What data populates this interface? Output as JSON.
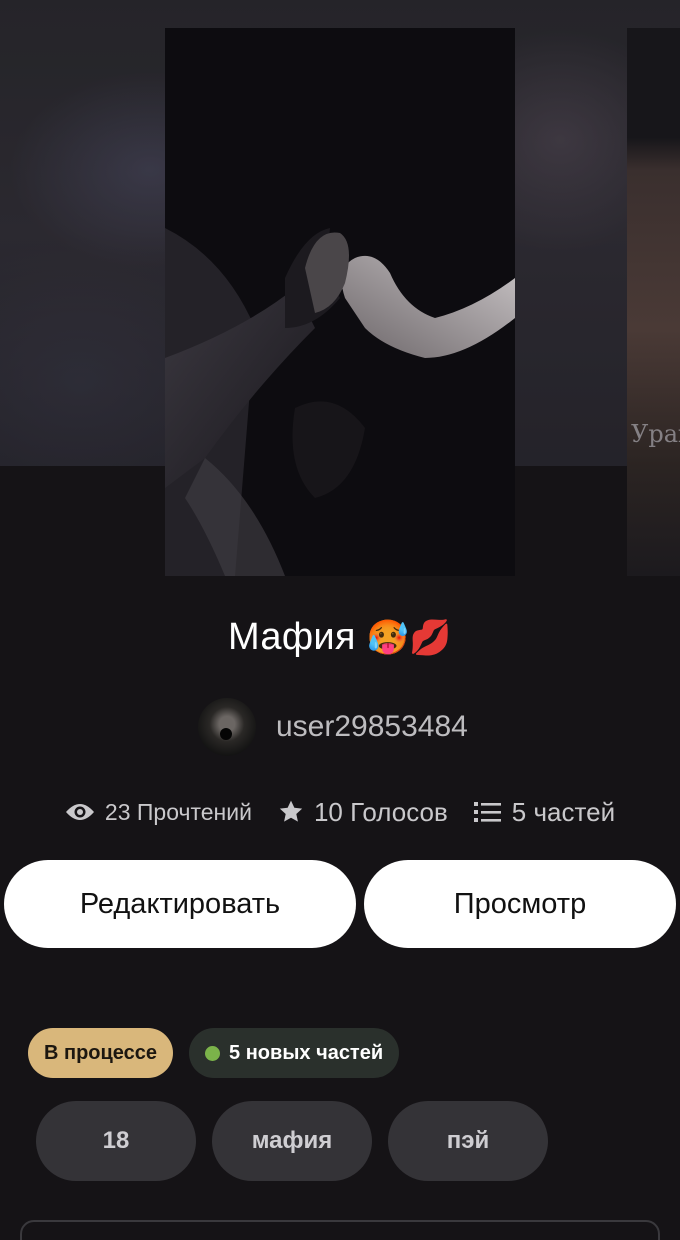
{
  "story": {
    "title": "Мафия",
    "title_emojis": "🥵💋",
    "author": "user29853484"
  },
  "stats": {
    "reads": "23 Прочтений",
    "votes": "10 Голосов",
    "parts": "5 частей"
  },
  "actions": {
    "edit_label": "Редактировать",
    "preview_label": "Просмотр"
  },
  "status": {
    "state_label": "В процессе",
    "new_parts_label": "5 новых частей"
  },
  "tags": [
    "18",
    "мафия",
    "пэй"
  ],
  "next_cover": {
    "visible_text": "Ураг"
  },
  "colors": {
    "background": "#151316",
    "status_chip": "#d9b77b",
    "new_dot": "#7bb34a",
    "tag_bg": "#343337",
    "button_bg": "#ffffff"
  },
  "icons": {
    "reads": "eye-icon",
    "votes": "star-icon",
    "parts": "list-icon"
  }
}
